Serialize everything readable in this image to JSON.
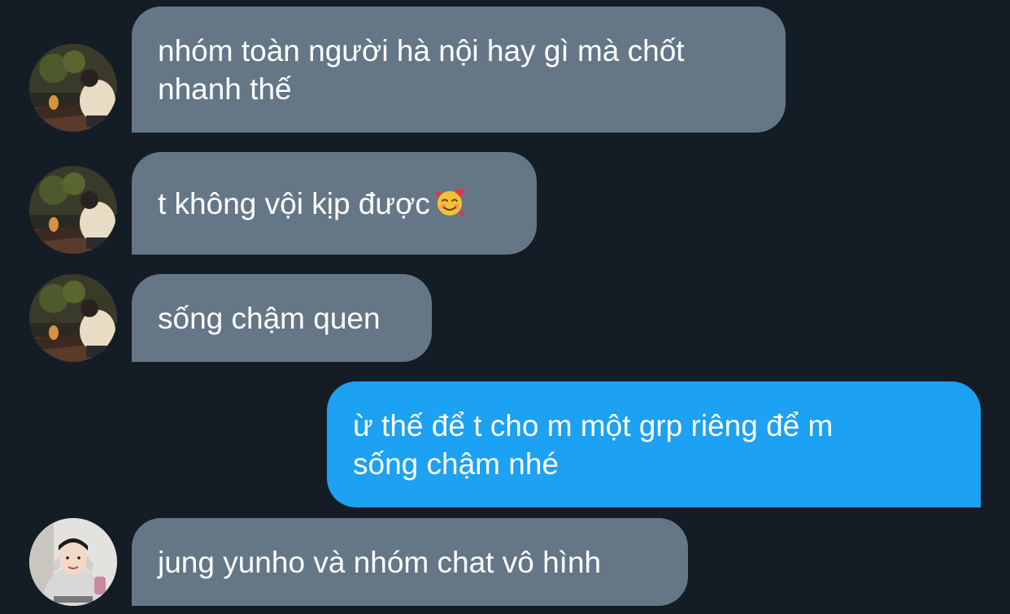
{
  "messages": [
    {
      "direction": "incoming",
      "avatar": "avatar-photo-cat",
      "lines": [
        "nhóm toàn người hà nội hay gì mà chốt",
        "nhanh thế"
      ]
    },
    {
      "direction": "incoming",
      "avatar": "avatar-photo-cat",
      "lines": [
        "t không vội kịp được"
      ],
      "emoji": "smiling-face-with-hearts-icon"
    },
    {
      "direction": "incoming",
      "avatar": "avatar-photo-cat",
      "lines": [
        "sống chậm quen"
      ]
    },
    {
      "direction": "outgoing",
      "lines": [
        "ừ thế để t cho m một grp riêng để m",
        "sống chậm nhé"
      ]
    },
    {
      "direction": "incoming",
      "avatar": "avatar-photo-hoodie",
      "lines": [
        "jung yunho và nhóm chat vô hình"
      ]
    }
  ],
  "colors": {
    "background": "#141d26",
    "incoming_bubble": "#657786",
    "outgoing_bubble": "#1da1f2",
    "text": "#ffffff"
  }
}
